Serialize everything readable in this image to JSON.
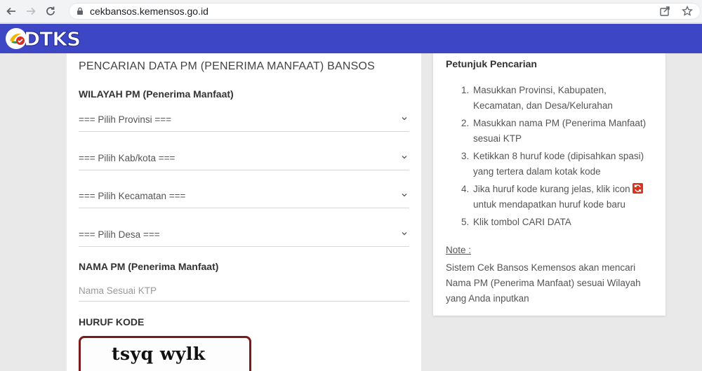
{
  "browser": {
    "url": "cekbansos.kemensos.go.id"
  },
  "header": {
    "logo_text": "DTKS"
  },
  "form": {
    "title": "PENCARIAN DATA PM (PENERIMA MANFAAT) BANSOS",
    "wilayah_label": "WILAYAH PM (Penerima Manfaat)",
    "selects": {
      "provinsi": "=== Pilih Provinsi ===",
      "kabkota": "=== Pilih Kab/kota ===",
      "kecamatan": "=== Pilih Kecamatan ===",
      "desa": "=== Pilih Desa ==="
    },
    "nama_label": "NAMA PM (Penerima Manfaat)",
    "nama_placeholder": "Nama Sesuai KTP",
    "kode_label": "HURUF KODE",
    "captcha_code": "tsyq  wylk"
  },
  "help": {
    "title": "Petunjuk Pencarian",
    "steps": [
      "Masukkan Provinsi, Kabupaten, Kecamatan, dan Desa/Kelurahan",
      "Masukkan nama PM (Penerima Manfaat) sesuai KTP",
      "Ketikkan 8 huruf kode (dipisahkan spasi) yang tertera dalam kotak kode",
      "Jika huruf kode kurang jelas, klik icon",
      "untuk mendapatkan huruf kode baru",
      "Klik tombol CARI DATA"
    ],
    "step_numbers": [
      "1.",
      "2.",
      "3.",
      "4.",
      "5."
    ],
    "note_title": "Note :",
    "note_text": "Sistem Cek Bansos Kemensos akan mencari Nama PM (Penerima Manfaat) sesuai Wilayah yang Anda inputkan"
  },
  "colors": {
    "header_bg": "#3d47c6",
    "captcha_border": "#7a1a1a",
    "refresh_icon": "#d9321f"
  }
}
